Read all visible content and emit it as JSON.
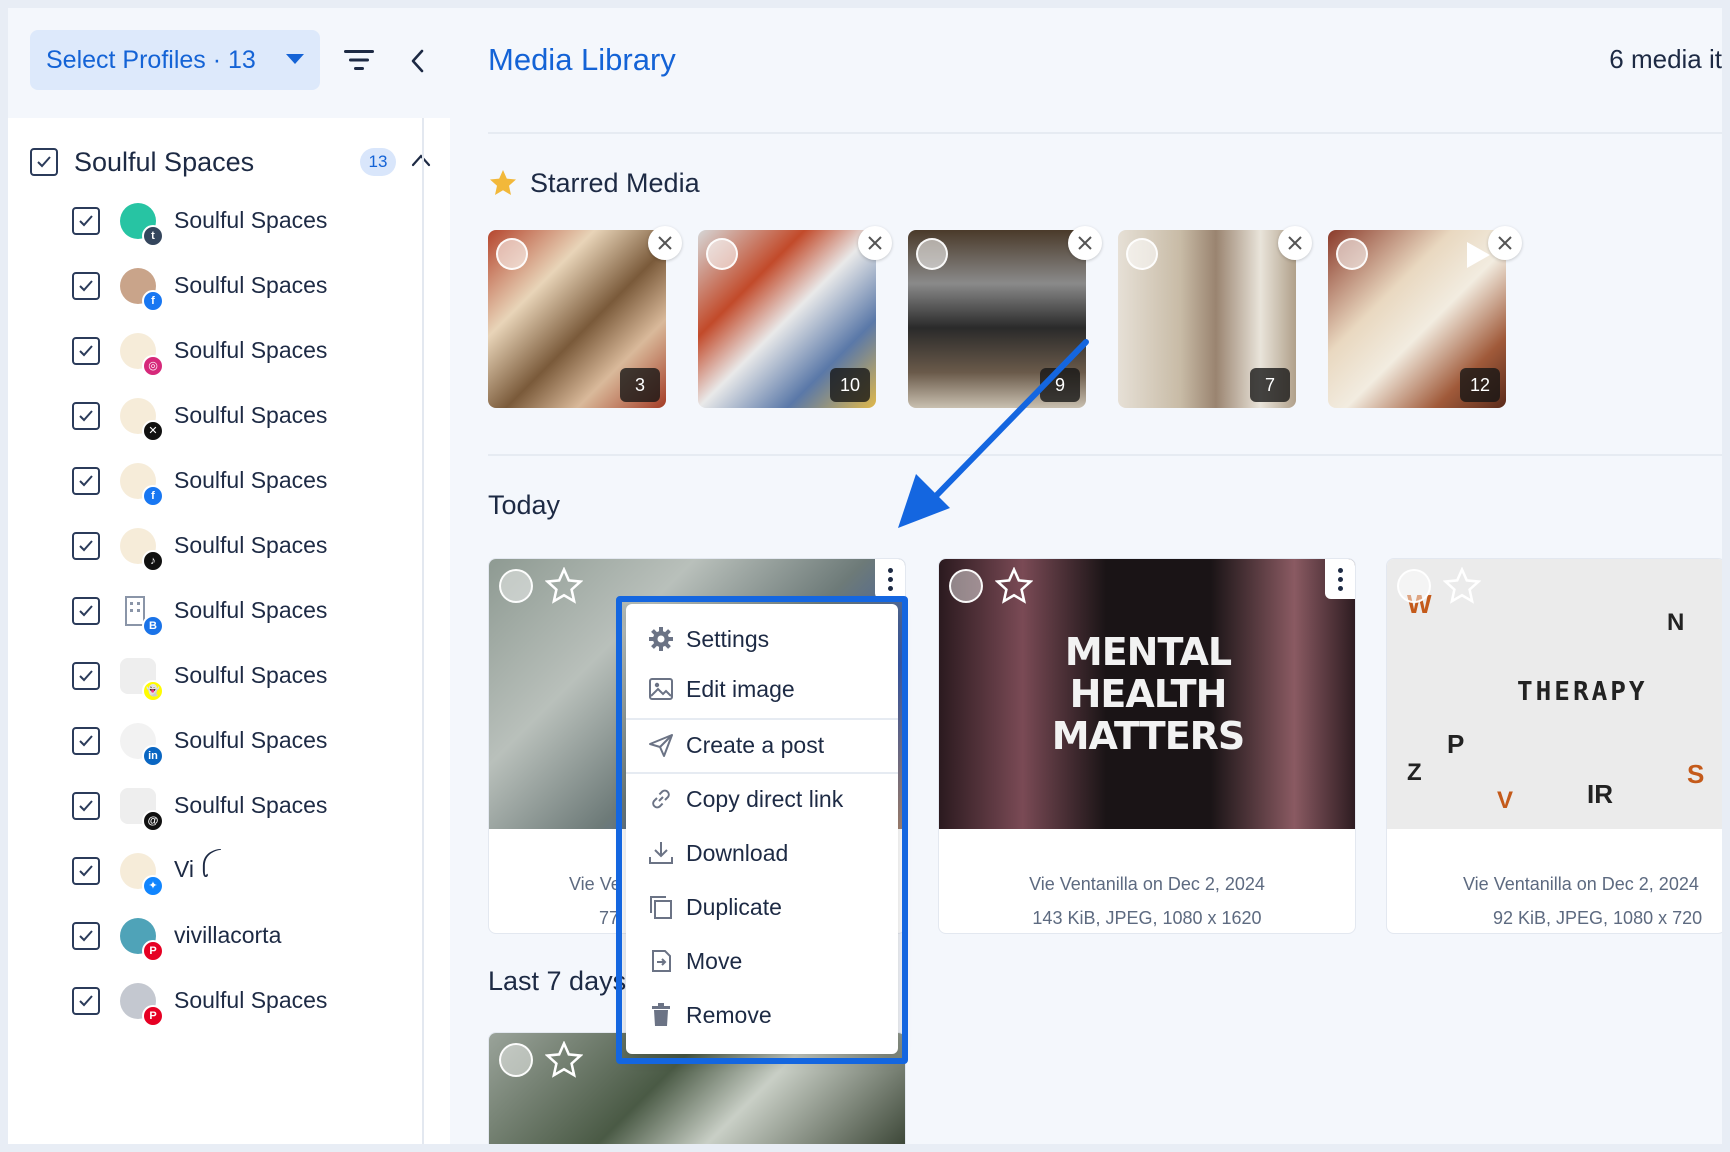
{
  "sidebar": {
    "select_profiles_label": "Select Profiles · 13",
    "group": {
      "label": "Soulful Spaces",
      "count": "13"
    },
    "profiles": [
      {
        "label": "Soulful Spaces",
        "network": "tumblr"
      },
      {
        "label": "Soulful Spaces",
        "network": "facebook"
      },
      {
        "label": "Soulful Spaces",
        "network": "instagram"
      },
      {
        "label": "Soulful Spaces",
        "network": "x"
      },
      {
        "label": "Soulful Spaces",
        "network": "facebook"
      },
      {
        "label": "Soulful Spaces",
        "network": "tiktok"
      },
      {
        "label": "Soulful Spaces",
        "network": "google-business"
      },
      {
        "label": "Soulful Spaces",
        "network": "snapchat"
      },
      {
        "label": "Soulful Spaces",
        "network": "linkedin"
      },
      {
        "label": "Soulful Spaces",
        "network": "threads"
      },
      {
        "label": "Vi ꪶ",
        "network": "bluesky"
      },
      {
        "label": "vivillacorta",
        "network": "pinterest"
      },
      {
        "label": "Soulful Spaces",
        "network": "pinterest"
      }
    ]
  },
  "main": {
    "title": "Media Library",
    "media_count": "6 media it",
    "starred": {
      "title": "Starred Media",
      "items": [
        {
          "count": "3"
        },
        {
          "count": "10"
        },
        {
          "count": "9"
        },
        {
          "count": "7"
        },
        {
          "count": "12"
        }
      ]
    },
    "today": {
      "title": "Today",
      "cards": [
        {
          "meta1": "Vie Ve",
          "meta2": "77"
        },
        {
          "meta1": "Vie Ventanilla on Dec 2, 2024",
          "meta2": "143 KiB, JPEG, 1080 x 1620"
        },
        {
          "meta1": "Vie Ventanilla on Dec 2, 2024",
          "meta2": "92 KiB, JPEG, 1080 x 720"
        }
      ]
    },
    "last7": {
      "title": "Last 7 days"
    }
  },
  "context_menu": {
    "items": [
      {
        "label": "Settings",
        "icon": "gear-icon"
      },
      {
        "label": "Edit image",
        "icon": "image-icon"
      },
      {
        "label": "Create a post",
        "icon": "send-icon"
      },
      {
        "label": "Copy direct link",
        "icon": "link-icon"
      },
      {
        "label": "Download",
        "icon": "download-icon"
      },
      {
        "label": "Duplicate",
        "icon": "duplicate-icon"
      },
      {
        "label": "Move",
        "icon": "move-icon"
      },
      {
        "label": "Remove",
        "icon": "trash-icon"
      }
    ]
  },
  "colors": {
    "accent": "#1463d6",
    "highlight": "#1466e0",
    "text": "#1d2a44",
    "star": "#f2b83a"
  },
  "thumb_text": {
    "card2_line1": "MENTAL",
    "card2_line2": "HEALTH",
    "card2_line3": "MATTERS",
    "card3_word": "THERAPY"
  }
}
